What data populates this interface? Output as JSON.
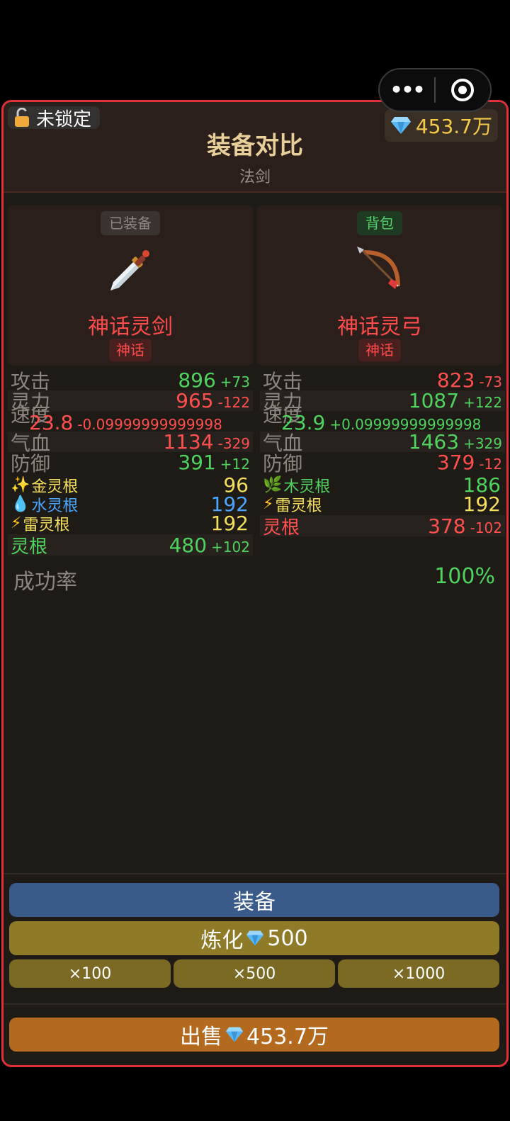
{
  "header": {
    "lock_label": "未锁定",
    "title": "装备对比",
    "subtitle": "法剑",
    "gems": "453.7万"
  },
  "left": {
    "tag": "已装备",
    "name": "神话灵剑",
    "rarity": "神话",
    "stats": {
      "attack": {
        "label": "攻击",
        "value": "896",
        "diff": "+73"
      },
      "spirit": {
        "label": "灵力",
        "value": "965",
        "diff": "-122"
      },
      "speed": {
        "label": "速度",
        "value": "23.8",
        "diff": "-0.09999999999998"
      },
      "hp": {
        "label": "气血",
        "value": "1134",
        "diff": "-329"
      },
      "defense": {
        "label": "防御",
        "value": "391",
        "diff": "+12"
      }
    },
    "roots": [
      {
        "icon": "sparkle-icon",
        "label": "金灵根",
        "value": "96"
      },
      {
        "icon": "water-drop-icon",
        "label": "水灵根",
        "value": "192"
      },
      {
        "icon": "lightning-icon",
        "label": "雷灵根",
        "value": "192"
      }
    ],
    "root_total": {
      "label": "灵根",
      "value": "480",
      "diff": "+102"
    }
  },
  "right": {
    "tag": "背包",
    "name": "神话灵弓",
    "rarity": "神话",
    "stats": {
      "attack": {
        "label": "攻击",
        "value": "823",
        "diff": "-73"
      },
      "spirit": {
        "label": "灵力",
        "value": "1087",
        "diff": "+122"
      },
      "speed": {
        "label": "速度",
        "value": "23.9",
        "diff": "+0.09999999999998"
      },
      "hp": {
        "label": "气血",
        "value": "1463",
        "diff": "+329"
      },
      "defense": {
        "label": "防御",
        "value": "379",
        "diff": "-12"
      }
    },
    "roots": [
      {
        "icon": "herb-icon",
        "label": "木灵根",
        "value": "186"
      },
      {
        "icon": "lightning-icon",
        "label": "雷灵根",
        "value": "192"
      }
    ],
    "root_total": {
      "label": "灵根",
      "value": "378",
      "diff": "-102"
    }
  },
  "success": {
    "label": "成功率",
    "value": "100%"
  },
  "buttons": {
    "equip": "装备",
    "refine_label": "炼化",
    "refine_cost": "500",
    "x100": "×100",
    "x500": "×500",
    "x1000": "×1000",
    "sell_label": "出售",
    "sell_price": "453.7万"
  },
  "colors": {
    "accent_border": "#e0313a",
    "positive": "#4fd35f",
    "negative": "#ff4f4f",
    "gold": "#f4c94a"
  }
}
